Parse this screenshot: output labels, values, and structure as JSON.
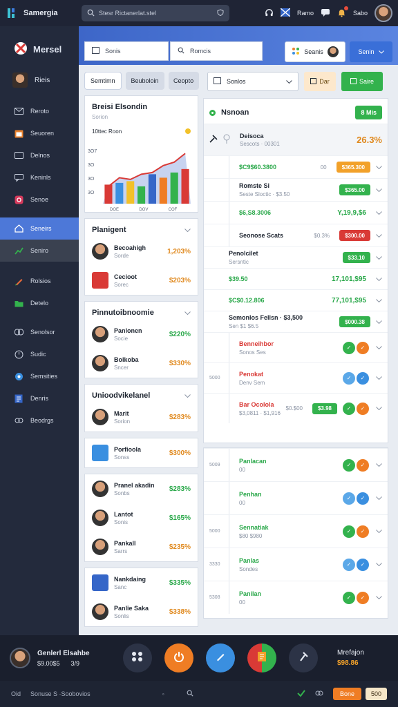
{
  "topbar": {
    "app_title": "Samergia",
    "search_placeholder": "Stesr Rictanerlat.stel",
    "right_label_1": "Ramo",
    "right_label_2": "Sabo",
    "notif_count": "5"
  },
  "sidebar": {
    "brand": "Mersel",
    "user": "Rieis",
    "items": [
      {
        "label": "Reroto",
        "icon": "mail-icon"
      },
      {
        "label": "Seuoren",
        "icon": "calendar-icon"
      },
      {
        "label": "Delnos",
        "icon": "card-icon"
      },
      {
        "label": "Keninls",
        "icon": "message-icon"
      },
      {
        "label": "Senoe",
        "icon": "instagram-icon"
      }
    ],
    "active_item": "Seneirs",
    "sub_item": "Seniro",
    "items2": [
      {
        "label": "Rolsios",
        "icon": "pencil-icon"
      },
      {
        "label": "Detelo",
        "icon": "folder-icon"
      }
    ],
    "items3": [
      {
        "label": "Senolsor",
        "icon": "link-icon"
      },
      {
        "label": "Sudic",
        "icon": "clock-icon"
      },
      {
        "label": "Semsities",
        "icon": "settings-icon"
      },
      {
        "label": "Denris",
        "icon": "doc-icon"
      },
      {
        "label": "Beodrgs",
        "icon": "share-icon"
      }
    ]
  },
  "header": {
    "input1": "Sonis",
    "input2": "Romcis",
    "profile_label": "Seanis",
    "action_button": "Senin"
  },
  "left": {
    "segments": [
      "Semtimn",
      "Beuboloin",
      "Ceopto"
    ],
    "chart_title": "Breisi Elsondin",
    "chart_sub": "Sorion",
    "chart_label": "10ttec Roon",
    "chart_data": {
      "type": "bar",
      "categories": [
        "DOE",
        "DOV",
        "COF"
      ],
      "ytick_labels": [
        "3O7",
        "3O",
        "3O",
        "3O"
      ],
      "series": [
        {
          "name": "",
          "values": [
            22,
            24,
            26,
            20,
            34,
            30,
            36,
            40
          ]
        }
      ],
      "line": [
        20,
        30,
        28,
        34,
        36,
        44,
        48,
        58
      ]
    },
    "sections": [
      {
        "title": "Planigent",
        "rows": [
          {
            "name": "Becoahigh",
            "sub": "Sorde",
            "value": "1,203%",
            "color": "or",
            "pic": "person"
          },
          {
            "name": "Cecioot",
            "sub": "Sorec",
            "value": "$203%",
            "color": "or",
            "pic": "red-square"
          }
        ]
      },
      {
        "title": "Pinnutoibnoomie",
        "rows": [
          {
            "name": "Panlonen",
            "sub": "Socie",
            "value": "$220%",
            "color": "up",
            "pic": "person"
          },
          {
            "name": "Bolkoba",
            "sub": "Sncer",
            "value": "$330%",
            "color": "or",
            "pic": "person"
          }
        ]
      },
      {
        "title": "Unioodvikelanel",
        "rows": [
          {
            "name": "Marit",
            "sub": "Sorion",
            "value": "$283%",
            "color": "or",
            "pic": "person"
          }
        ]
      },
      {
        "title": "",
        "rows": [
          {
            "name": "Porfioola",
            "sub": "Sonss",
            "value": "$300%",
            "color": "or",
            "pic": "blue-square"
          }
        ]
      },
      {
        "title": "",
        "rows": [
          {
            "name": "Pranel akadin",
            "sub": "Sonbs",
            "value": "$283%",
            "color": "up",
            "pic": "person"
          },
          {
            "name": "Lantot",
            "sub": "Sonis",
            "value": "$165%",
            "color": "up",
            "pic": "person"
          },
          {
            "name": "Pankall",
            "sub": "Sarrs",
            "value": "$235%",
            "color": "or",
            "pic": "person"
          }
        ]
      },
      {
        "title": "",
        "rows": [
          {
            "name": "Nankdaing",
            "sub": "Sanc",
            "value": "$335%",
            "color": "up",
            "pic": "facebook"
          },
          {
            "name": "Panlie Saka",
            "sub": "Sonlis",
            "value": "$338%",
            "color": "or",
            "pic": "person"
          }
        ]
      }
    ]
  },
  "right": {
    "select_label": "Sonlos",
    "pill1": "Dar",
    "pill2": "Saire",
    "panel_title": "Nsnoan",
    "panel_tag": "8 Mis",
    "first_row": {
      "title": "Deisoca",
      "sub": "Sescots · 00301",
      "value": "26.3%"
    },
    "group1": {
      "left_label_a": "I3",
      "left_label_b": "13",
      "lines": [
        {
          "a": "$C9$60.3800",
          "b": "00",
          "tag": "$365.300",
          "tag_color": "o"
        },
        {
          "a": "Romste Si",
          "a_sub": "Seste Sloctic · $3.50",
          "tag": "$365.00",
          "tag_color": "g"
        },
        {
          "a": "$6,S8.3006",
          "b": "",
          "tag2": "Y,19,9,$6",
          "tag": "",
          "tag_color": ""
        },
        {
          "a": "Seonose Scats",
          "b": "$0.3%",
          "tag": "$300.00",
          "tag_color": "r"
        }
      ]
    },
    "group2": {
      "lines": [
        {
          "a": "Penolcilet",
          "a_sub": "Sersntic",
          "tag": "$33.10",
          "tag_color": "g"
        },
        {
          "a": "$39.50",
          "b": "",
          "tag2": "17,101,$95"
        },
        {
          "a": "$C$0.12.806",
          "b": "",
          "tag2": "77,101,$95"
        },
        {
          "a": "Semonlos Fellsn · $3,500",
          "a_sub": "Sen $1 $6.5",
          "tag": "$000.38",
          "tag_color": "g"
        }
      ]
    },
    "group3": {
      "lines": [
        {
          "a": "Benneihbor",
          "a_sub": "Sonos Ses"
        },
        {
          "a": "Penokat",
          "a_sub": "Denv Sem",
          "left": "5000"
        },
        {
          "a": "Bar Ocolola",
          "a_sub": "$3,0811 · $1,916",
          "b": "$0.$00",
          "tag": "$3.98",
          "tag_color": "g"
        }
      ]
    },
    "group4": {
      "lines": [
        {
          "a": "Panlacan",
          "a_sub": "00",
          "left": "5009"
        },
        {
          "a": "Penhan",
          "a_sub": "00"
        },
        {
          "a": "Sennatiak",
          "a_sub": "$80 $980",
          "left": "5000"
        },
        {
          "a": "Panlas",
          "a_sub": "Sondes",
          "left": "3330"
        },
        {
          "a": "Panilan",
          "a_sub": "00",
          "left": "5308"
        }
      ]
    }
  },
  "bottom": {
    "user_name": "Genlerl Elsahbe",
    "user_sub": "$9.00$5",
    "user_count": "3/9",
    "right_title": "Mrefajon",
    "right_value": "$98.86"
  },
  "status": {
    "left": "Oid",
    "text": "Sonuse S ·Soobovios",
    "btn1": "Bone",
    "btn2": "500"
  },
  "colors": {
    "accent": "#4d78d8",
    "green": "#33b24d",
    "orange": "#f2a12a",
    "red": "#d93a36"
  }
}
